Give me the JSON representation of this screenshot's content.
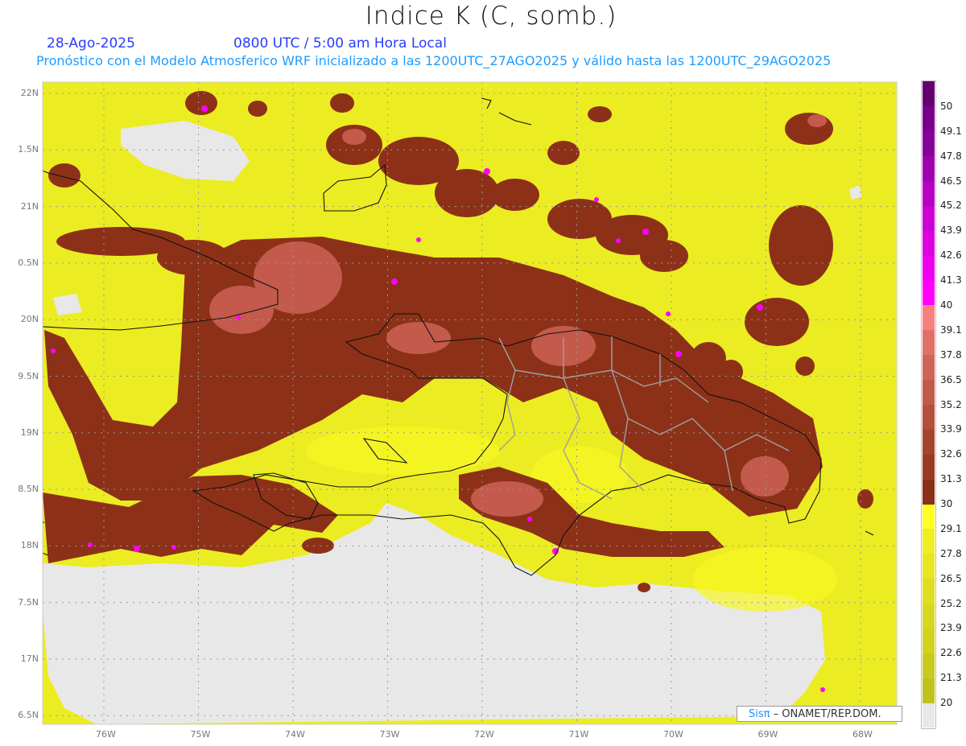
{
  "header": {
    "title": "Indice K (C, somb.)",
    "date": "28-Ago-2025",
    "time": "0800 UTC / 5:00 am Hora Local",
    "subtitle": "Pronóstico con el Modelo Atmosferico WRF inicializado a las 1200UTC_27AGO2025 y válido hasta las  1200UTC_29AGO2025"
  },
  "axes": {
    "lat_labels": [
      "22N",
      "1.5N",
      "21N",
      "0.5N",
      "20N",
      "9.5N",
      "19N",
      "8.5N",
      "18N",
      "7.5N",
      "17N",
      "6.5N"
    ],
    "lon_labels": [
      "76W",
      "75W",
      "74W",
      "73W",
      "72W",
      "71W",
      "70W",
      "69W",
      "68W"
    ]
  },
  "colorbar": {
    "labels": [
      "20",
      "21.3",
      "22.6",
      "23.9",
      "25.2",
      "26.5",
      "27.8",
      "29.1",
      "30",
      "31.3",
      "32.6",
      "33.9",
      "35.2",
      "36.5",
      "37.8",
      "39.1",
      "40",
      "41.3",
      "42.6",
      "43.9",
      "45.2",
      "46.5",
      "47.8",
      "49.1",
      "50"
    ],
    "colors": [
      "#e8e8e8",
      "#c0c01e",
      "#c9c91f",
      "#d2d21f",
      "#d8d820",
      "#dfdf20",
      "#e6e621",
      "#eeee22",
      "#ffff22",
      "#8a3018",
      "#993b22",
      "#a6442c",
      "#b44f3c",
      "#c05a4a",
      "#cf6457",
      "#e07068",
      "#f78080",
      "#ff00ff",
      "#ee00ee",
      "#dd00e0",
      "#cc00d4",
      "#b600c4",
      "#9e00b0",
      "#86009a",
      "#760088",
      "#640070"
    ]
  },
  "footer": {
    "logo_sis": "Sisπ",
    "logo_text": " – ONAMET/REP.DOM."
  }
}
